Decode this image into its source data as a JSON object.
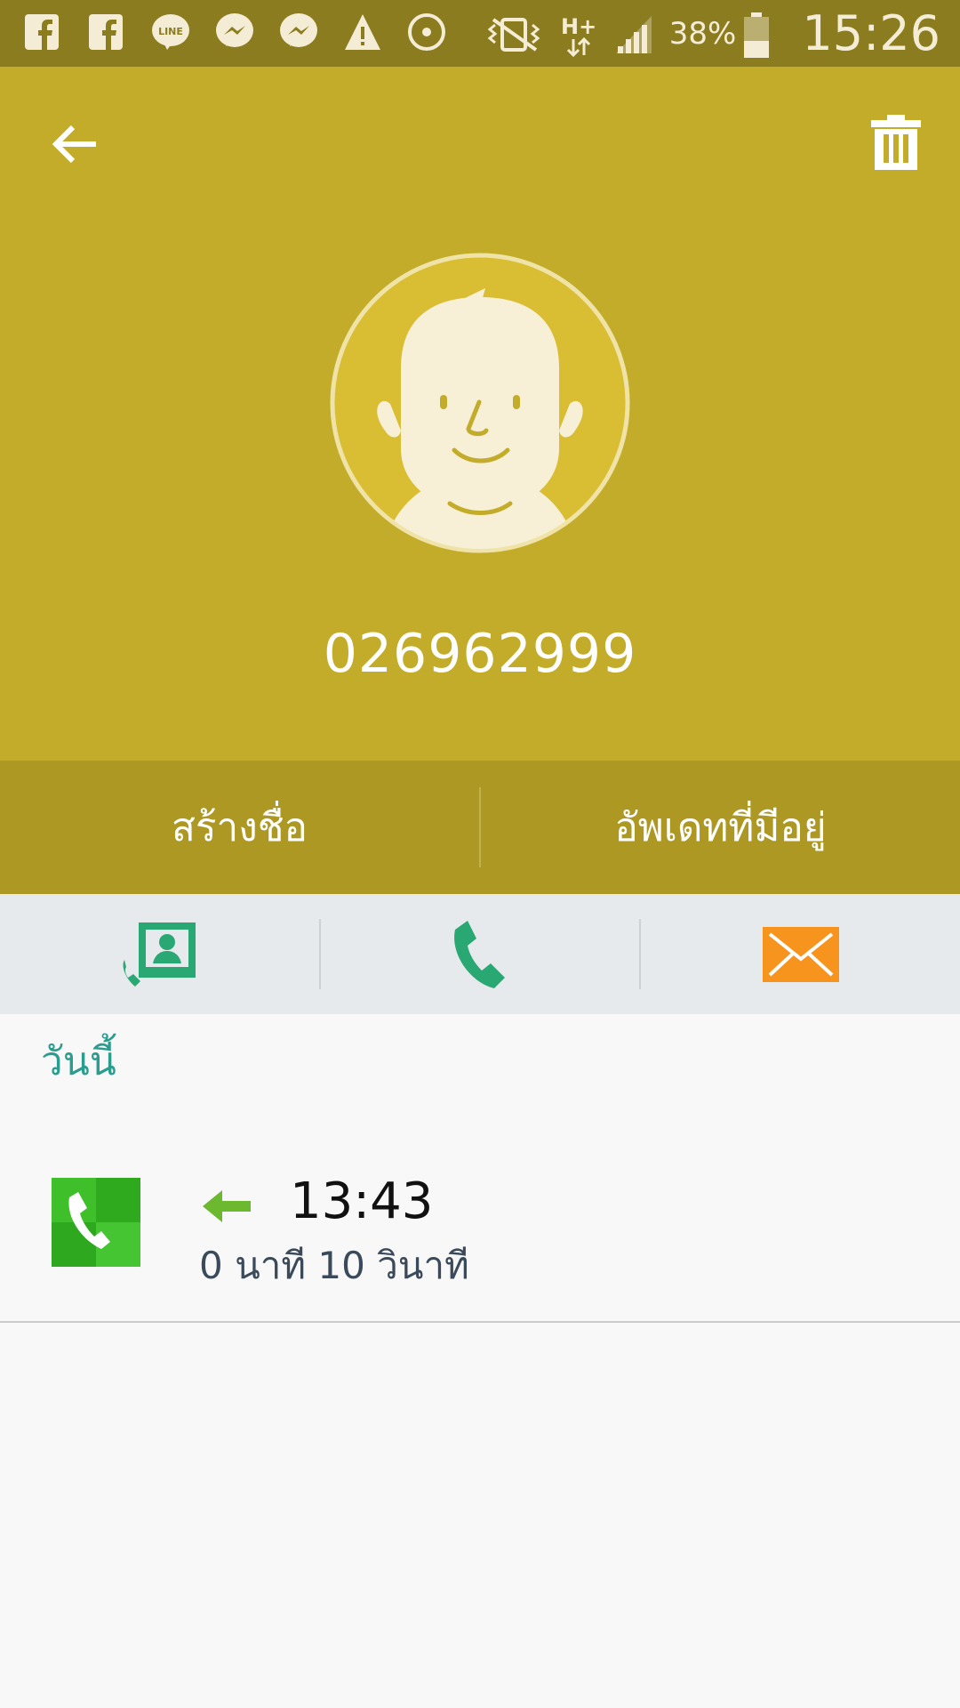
{
  "status_bar": {
    "battery": "38%",
    "time": "15:26",
    "network": "H+",
    "notification_icons": [
      "facebook-icon",
      "facebook-icon",
      "line-icon",
      "messenger-icon",
      "messenger-icon",
      "warning-icon",
      "record-icon"
    ],
    "system_icons": [
      "vibrate-icon",
      "network-icon",
      "signal-icon",
      "battery-icon"
    ]
  },
  "header": {
    "phone_number": "026962999",
    "background_color": "#c3ac2a"
  },
  "contact_actions": {
    "create": "สร้างชื่อ",
    "update": "อัพเดทที่มีอยู่"
  },
  "quick_actions": [
    "contact-call-icon",
    "phone-icon",
    "message-icon"
  ],
  "call_log": {
    "section_label": "วันนี้",
    "entries": [
      {
        "time": "13:43",
        "duration": "0 นาที 10 วินาที",
        "direction": "incoming"
      }
    ]
  },
  "colors": {
    "accent_teal": "#2a9d8f",
    "call_green": "#2aa874",
    "message_orange": "#f7941d",
    "incoming_green": "#6cb82f"
  }
}
